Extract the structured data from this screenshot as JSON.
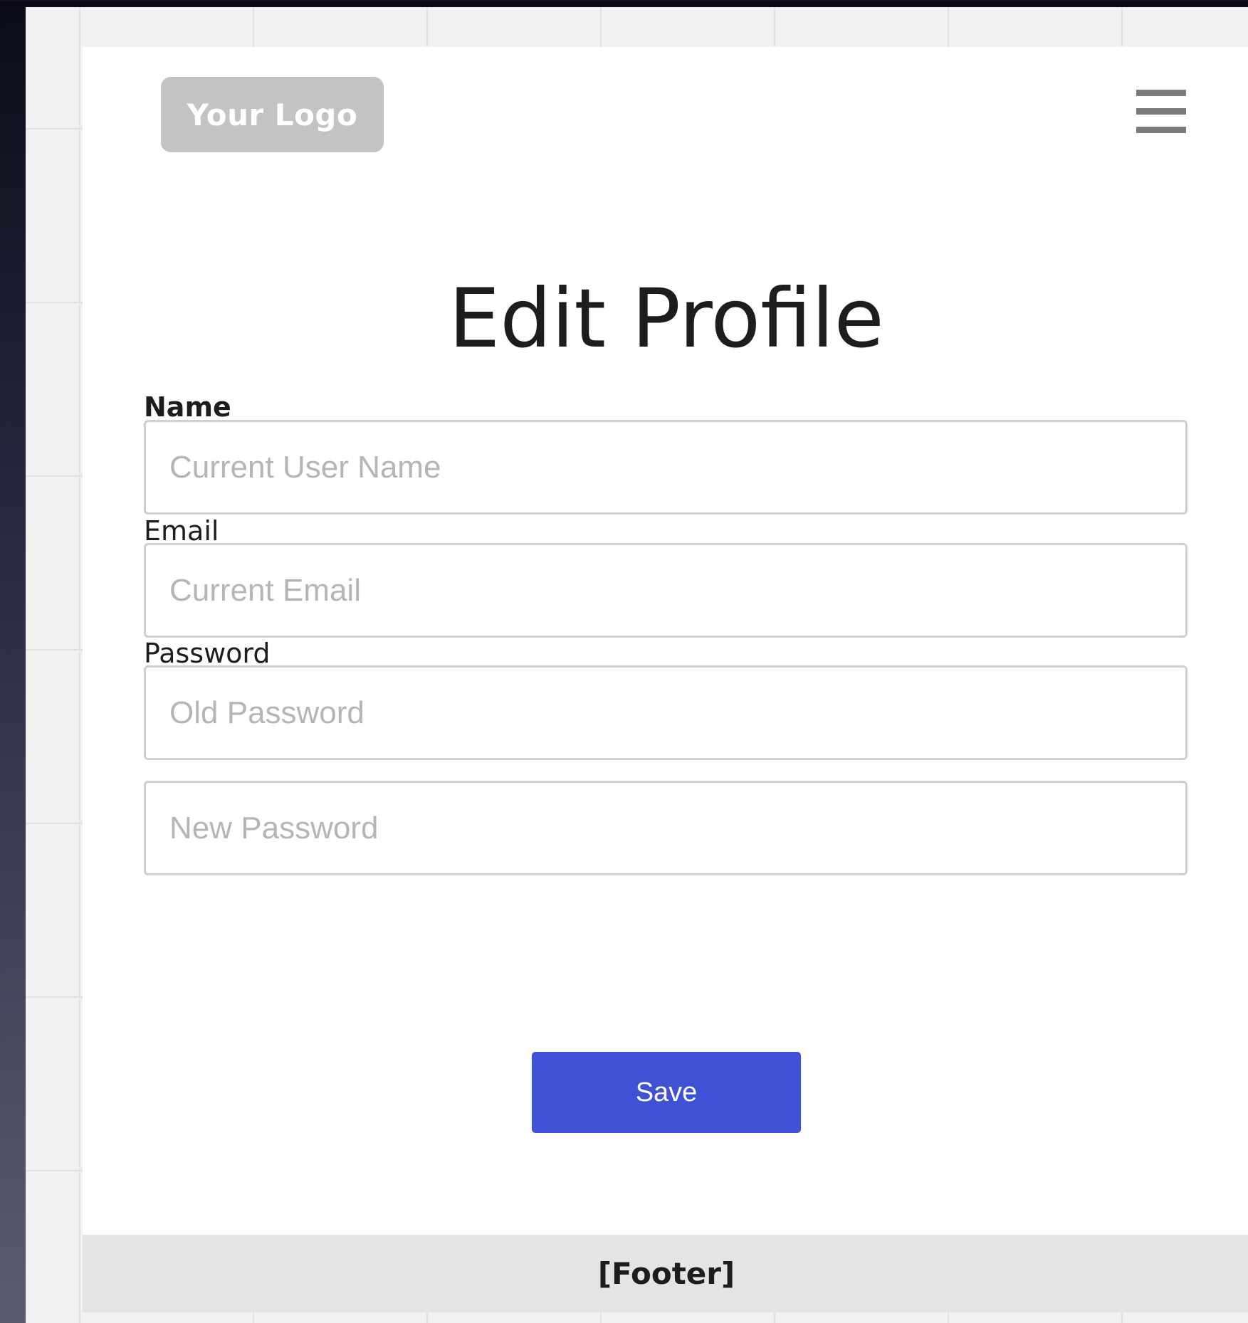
{
  "header": {
    "logo_text": "Your Logo",
    "menu_icon": "hamburger-menu-icon"
  },
  "page": {
    "title": "Edit Profile"
  },
  "form": {
    "name_label": "Name",
    "name_placeholder": "Current User Name",
    "email_label": "Email",
    "email_placeholder": "Current Email",
    "password_label": "Password",
    "old_password_placeholder": "Old Password",
    "new_password_placeholder": "New Password",
    "save_label": "Save"
  },
  "footer": {
    "text": "[Footer]"
  },
  "colors": {
    "accent": "#3f51d4",
    "logo_bg": "#c3c3c3",
    "footer_bg": "#e4e4e4"
  }
}
